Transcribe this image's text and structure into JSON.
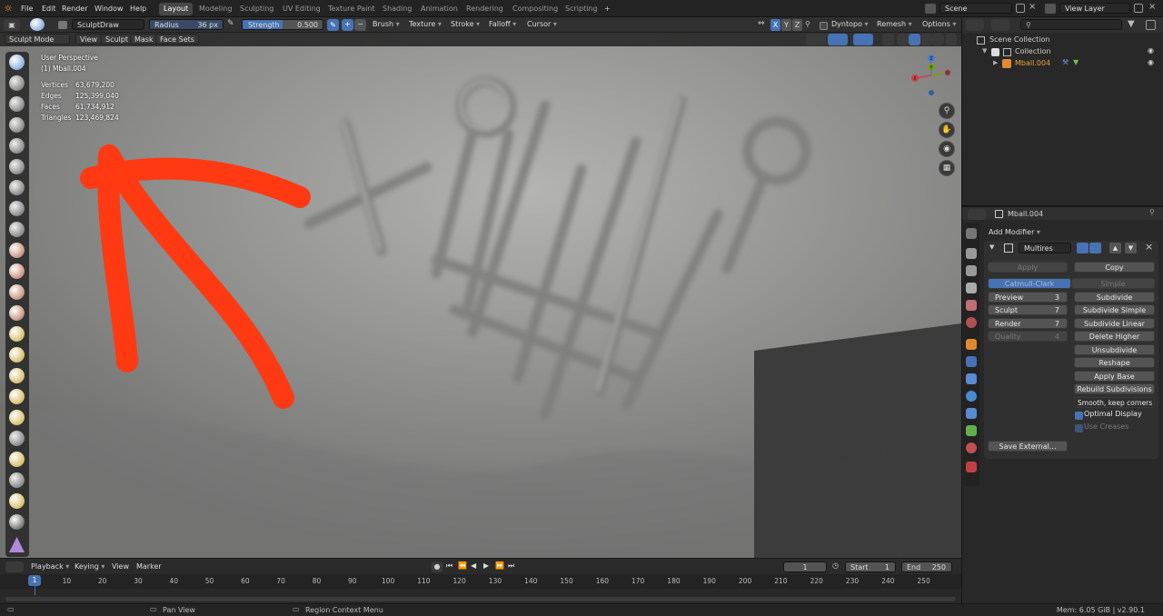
{
  "topbar": {
    "menus": [
      "File",
      "Edit",
      "Render",
      "Window",
      "Help"
    ],
    "workspaces": [
      "Layout",
      "Modeling",
      "Sculpting",
      "UV Editing",
      "Texture Paint",
      "Shading",
      "Animation",
      "Rendering",
      "Compositing",
      "Scripting"
    ],
    "add_tab": "+",
    "scene": "Scene",
    "view_layer": "View Layer"
  },
  "toolheader": {
    "brush_name": "SculptDraw",
    "radius_label": "Radius",
    "radius_value": "36 px",
    "strength_label": "Strength",
    "strength_value": "0.500",
    "strength_fraction": 0.5,
    "menus": [
      "Brush",
      "Texture",
      "Stroke",
      "Falloff",
      "Cursor"
    ],
    "axes": [
      "X",
      "Y",
      "Z"
    ],
    "dyntopo": "Dyntopo",
    "remesh": "Remesh",
    "options": "Options"
  },
  "modeheader": {
    "mode": "Sculpt Mode",
    "items": [
      "View",
      "Sculpt",
      "Mask",
      "Face Sets"
    ]
  },
  "viewport": {
    "perspective": "User Perspective",
    "object": "(1) Mball.004",
    "stats": [
      {
        "label": "Vertices",
        "value": "63,679,200"
      },
      {
        "label": "Edges",
        "value": "125,399,040"
      },
      {
        "label": "Faces",
        "value": "61,734,912"
      },
      {
        "label": "Triangles",
        "value": "123,469,824"
      }
    ],
    "gizmo": {
      "x": "X",
      "y": "Y",
      "z": "Z"
    }
  },
  "outliner": {
    "items": [
      "Scene Collection",
      "Collection",
      "Mball.004"
    ]
  },
  "properties": {
    "object": "Mball.004",
    "add_modifier": "Add Modifier",
    "modifier_name": "Multires",
    "apply": "Apply",
    "copy": "Copy",
    "catmull": "Catmull-Clark",
    "simple": "Simple",
    "levels": [
      {
        "label": "Preview",
        "value": "3"
      },
      {
        "label": "Sculpt",
        "value": "7"
      },
      {
        "label": "Render",
        "value": "7"
      },
      {
        "label": "Quality",
        "value": "4"
      }
    ],
    "actions": [
      "Subdivide",
      "Subdivide Simple",
      "Subdivide Linear",
      "Delete Higher",
      "Unsubdivide",
      "Reshape",
      "Apply Base",
      "Rebuild Subdivisions"
    ],
    "uv_smooth": "Smooth, keep corners",
    "optimal_display": "Optimal Display",
    "use_creases": "Use Creases",
    "save_external": "Save External..."
  },
  "timeline": {
    "menus": [
      "Playback",
      "Keying",
      "View",
      "Marker"
    ],
    "current_frame": "1",
    "start_label": "Start",
    "start": "1",
    "end_label": "End",
    "end": "250",
    "ticks": [
      "1",
      "10",
      "20",
      "30",
      "40",
      "50",
      "60",
      "70",
      "80",
      "90",
      "100",
      "110",
      "120",
      "130",
      "140",
      "150",
      "160",
      "170",
      "180",
      "190",
      "200",
      "210",
      "220",
      "230",
      "240",
      "250"
    ]
  },
  "status": {
    "pan": "Pan View",
    "context": "Region Context Menu",
    "memory": "Mem: 6.05 GiB | v2.90.1"
  },
  "colors": {
    "accent": "#4772b3",
    "annotation": "#ff3a12",
    "active_object": "#f0a03c"
  }
}
